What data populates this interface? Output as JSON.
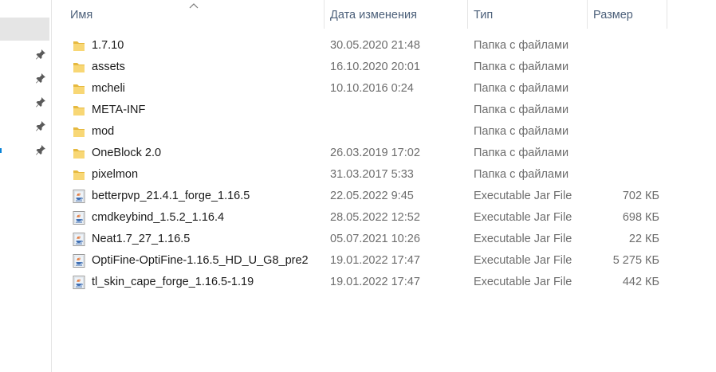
{
  "columns": {
    "name": "Имя",
    "date": "Дата изменения",
    "type": "Тип",
    "size": "Размер"
  },
  "icons": {
    "folder": "folder-icon",
    "jar": "java-jar-file-icon",
    "pin": "pin-icon",
    "sort": "sort-ascending-icon"
  },
  "files": [
    {
      "name": "1.7.10",
      "date": "30.05.2020 21:48",
      "type": "Папка с файлами",
      "size": "",
      "kind": "folder"
    },
    {
      "name": "assets",
      "date": "16.10.2020 20:01",
      "type": "Папка с файлами",
      "size": "",
      "kind": "folder"
    },
    {
      "name": "mcheli",
      "date": "10.10.2016 0:24",
      "type": "Папка с файлами",
      "size": "",
      "kind": "folder"
    },
    {
      "name": "META-INF",
      "date": "",
      "type": "Папка с файлами",
      "size": "",
      "kind": "folder"
    },
    {
      "name": "mod",
      "date": "",
      "type": "Папка с файлами",
      "size": "",
      "kind": "folder"
    },
    {
      "name": "OneBlock 2.0",
      "date": "26.03.2019 17:02",
      "type": "Папка с файлами",
      "size": "",
      "kind": "folder"
    },
    {
      "name": "pixelmon",
      "date": "31.03.2017 5:33",
      "type": "Папка с файлами",
      "size": "",
      "kind": "folder"
    },
    {
      "name": "betterpvp_21.4.1_forge_1.16.5",
      "date": "22.05.2022 9:45",
      "type": "Executable Jar File",
      "size": "702 КБ",
      "kind": "jar"
    },
    {
      "name": "cmdkeybind_1.5.2_1.16.4",
      "date": "28.05.2022 12:52",
      "type": "Executable Jar File",
      "size": "698 КБ",
      "kind": "jar"
    },
    {
      "name": "Neat1.7_27_1.16.5",
      "date": "05.07.2021 10:26",
      "type": "Executable Jar File",
      "size": "22 КБ",
      "kind": "jar"
    },
    {
      "name": "OptiFine-OptiFine-1.16.5_HD_U_G8_pre2",
      "date": "19.01.2022 17:47",
      "type": "Executable Jar File",
      "size": "5 275 КБ",
      "kind": "jar"
    },
    {
      "name": "tl_skin_cape_forge_1.16.5-1.19",
      "date": "19.01.2022 17:47",
      "type": "Executable Jar File",
      "size": "442 КБ",
      "kind": "jar"
    }
  ]
}
